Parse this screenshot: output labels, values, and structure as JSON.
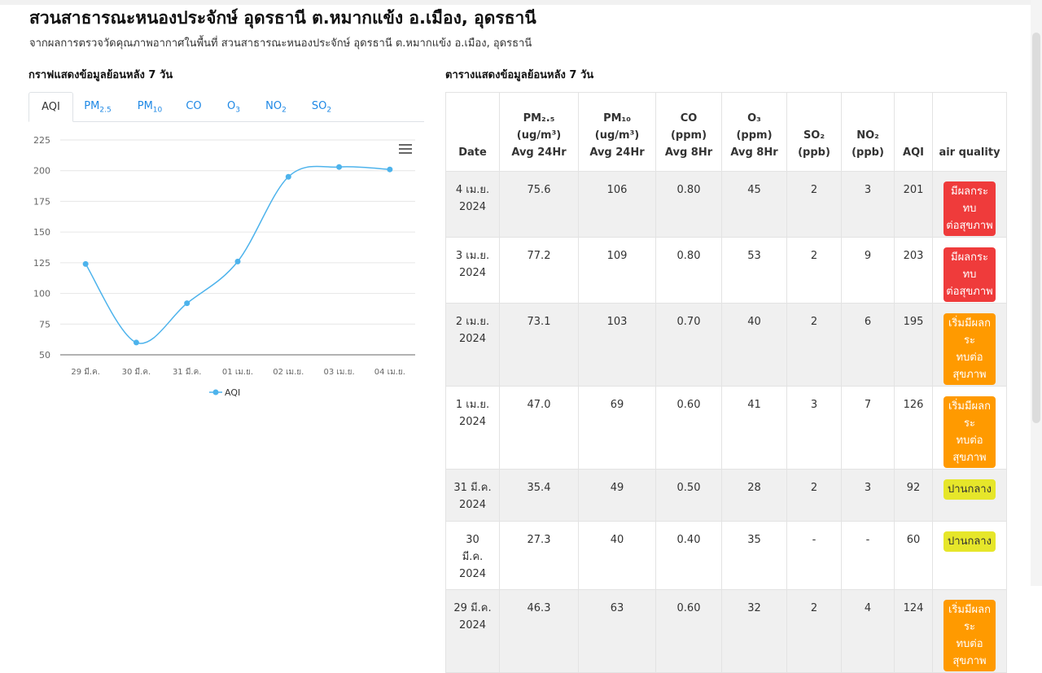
{
  "header": {
    "title": "สวนสาธารณะหนองประจักษ์ อุดรธานี ต.หมากแข้ง อ.เมือง, อุดรธานี",
    "subtitle": "จากผลการตรวจวัดคุณภาพอากาศในพื้นที่ สวนสาธารณะหนองประจักษ์ อุดรธานี ต.หมากแข้ง อ.เมือง, อุดรธานี"
  },
  "chart_section": {
    "title": "กราฟแสดงข้อมูลย้อนหลัง 7 วัน"
  },
  "table_section": {
    "title": "ตารางแสดงข้อมูลย้อนหลัง 7 วัน"
  },
  "tabs": [
    {
      "label": "AQI",
      "sub": ""
    },
    {
      "label": "PM",
      "sub": "2.5"
    },
    {
      "label": "PM",
      "sub": "10"
    },
    {
      "label": "CO",
      "sub": ""
    },
    {
      "label": "O",
      "sub": "3"
    },
    {
      "label": "NO",
      "sub": "2"
    },
    {
      "label": "SO",
      "sub": "2"
    }
  ],
  "chart_data": {
    "type": "line",
    "categories": [
      "29 มี.ค.",
      "30 มี.ค.",
      "31 มี.ค.",
      "01 เม.ย.",
      "02 เม.ย.",
      "03 เม.ย.",
      "04 เม.ย."
    ],
    "series": [
      {
        "name": "AQI",
        "values": [
          124,
          60,
          92,
          126,
          195,
          203,
          201
        ]
      }
    ],
    "yticks": [
      50,
      75,
      100,
      125,
      150,
      175,
      200,
      225
    ],
    "ylim": [
      50,
      225
    ],
    "grid": true,
    "legend": "bottom-center",
    "line_color": "#4db3ec"
  },
  "table": {
    "headers": [
      [
        "",
        "Date",
        ""
      ],
      [
        "PM₂.₅",
        "(ug/m³)",
        "Avg 24Hr"
      ],
      [
        "PM₁₀",
        "(ug/m³)",
        "Avg 24Hr"
      ],
      [
        "CO",
        "(ppm)",
        "Avg 8Hr"
      ],
      [
        "O₃",
        "(ppm)",
        "Avg 8Hr"
      ],
      [
        "",
        "SO₂",
        "(ppb)"
      ],
      [
        "",
        "NO₂",
        "(ppb)"
      ],
      [
        "",
        "",
        "AQI"
      ],
      [
        "",
        "",
        "air quality"
      ]
    ],
    "rows": [
      {
        "date": [
          "4 เม.ย.",
          "2024"
        ],
        "pm25": "75.6",
        "pm10": "106",
        "co": "0.80",
        "o3": "45",
        "so2": "2",
        "no2": "3",
        "aqi": "201",
        "quality": [
          "มีผลกระทบ",
          "ต่อสุขภาพ"
        ],
        "level": "red"
      },
      {
        "date": [
          "3 เม.ย.",
          "2024"
        ],
        "pm25": "77.2",
        "pm10": "109",
        "co": "0.80",
        "o3": "53",
        "so2": "2",
        "no2": "9",
        "aqi": "203",
        "quality": [
          "มีผลกระทบ",
          "ต่อสุขภาพ"
        ],
        "level": "red"
      },
      {
        "date": [
          "2 เม.ย.",
          "2024"
        ],
        "pm25": "73.1",
        "pm10": "103",
        "co": "0.70",
        "o3": "40",
        "so2": "2",
        "no2": "6",
        "aqi": "195",
        "quality": [
          "เริ่มมีผลกระ",
          "ทบต่อ",
          "สุขภาพ"
        ],
        "level": "orange"
      },
      {
        "date": [
          "1 เม.ย.",
          "2024"
        ],
        "pm25": "47.0",
        "pm10": "69",
        "co": "0.60",
        "o3": "41",
        "so2": "3",
        "no2": "7",
        "aqi": "126",
        "quality": [
          "เริ่มมีผลกระ",
          "ทบต่อ",
          "สุขภาพ"
        ],
        "level": "orange"
      },
      {
        "date": [
          "31 มี.ค.",
          "2024"
        ],
        "pm25": "35.4",
        "pm10": "49",
        "co": "0.50",
        "o3": "28",
        "so2": "2",
        "no2": "3",
        "aqi": "92",
        "quality": [
          "ปานกลาง"
        ],
        "level": "yellow"
      },
      {
        "date": [
          "30",
          "มี.ค.",
          "2024"
        ],
        "pm25": "27.3",
        "pm10": "40",
        "co": "0.40",
        "o3": "35",
        "so2": "-",
        "no2": "-",
        "aqi": "60",
        "quality": [
          "ปานกลาง"
        ],
        "level": "yellow"
      },
      {
        "date": [
          "29 มี.ค.",
          "2024"
        ],
        "pm25": "46.3",
        "pm10": "63",
        "co": "0.60",
        "o3": "32",
        "so2": "2",
        "no2": "4",
        "aqi": "124",
        "quality": [
          "เริ่มมีผลกระ",
          "ทบต่อ",
          "สุขภาพ"
        ],
        "level": "orange"
      }
    ]
  }
}
